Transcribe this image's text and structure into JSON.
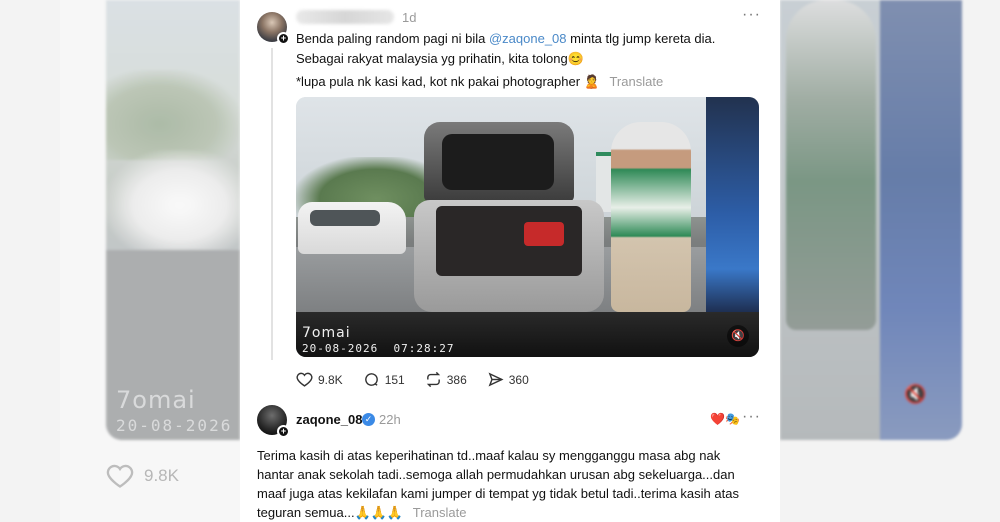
{
  "background": {
    "watermark_logo": "7omai",
    "watermark_date": "20-08-2026",
    "stat_likes": "9.8K"
  },
  "post": {
    "time": "1d",
    "text_part1": "Benda paling random pagi ni bila ",
    "mention": "@zaqone_08",
    "text_part2": " minta tlg jump kereta dia. Sebagai rakyat malaysia yg prihatin, kita tolong",
    "emoji_smile": "😊",
    "note": "*lupa pula nk kasi kad, kot nk pakai photographer",
    "emoji_note": "🙎",
    "translate": "Translate",
    "media": {
      "watermark_logo": "7omai",
      "watermark_timestamp": "20-08-2026  07:28:27"
    },
    "actions": {
      "likes": "9.8K",
      "comments": "151",
      "reposts": "386",
      "shares": "360"
    }
  },
  "reply": {
    "username": "zaqone_08",
    "verified_mark": "✓",
    "time": "22h",
    "reaction": "❤️🎭",
    "text": "Terima kasih di atas keperihatinan td..maaf kalau sy mengganggu masa abg nak hantar anak sekolah tadi..semoga allah permudahkan urusan abg sekeluarga...dan maaf juga atas kekilafan kami jumper di tempat yg tidak betul tadi..terima kasih atas teguran semua...",
    "emoji_pray": "🙏🙏🙏",
    "translate": "Translate"
  },
  "icons": {
    "more": "···",
    "plus": "+",
    "mute": "🔇"
  }
}
